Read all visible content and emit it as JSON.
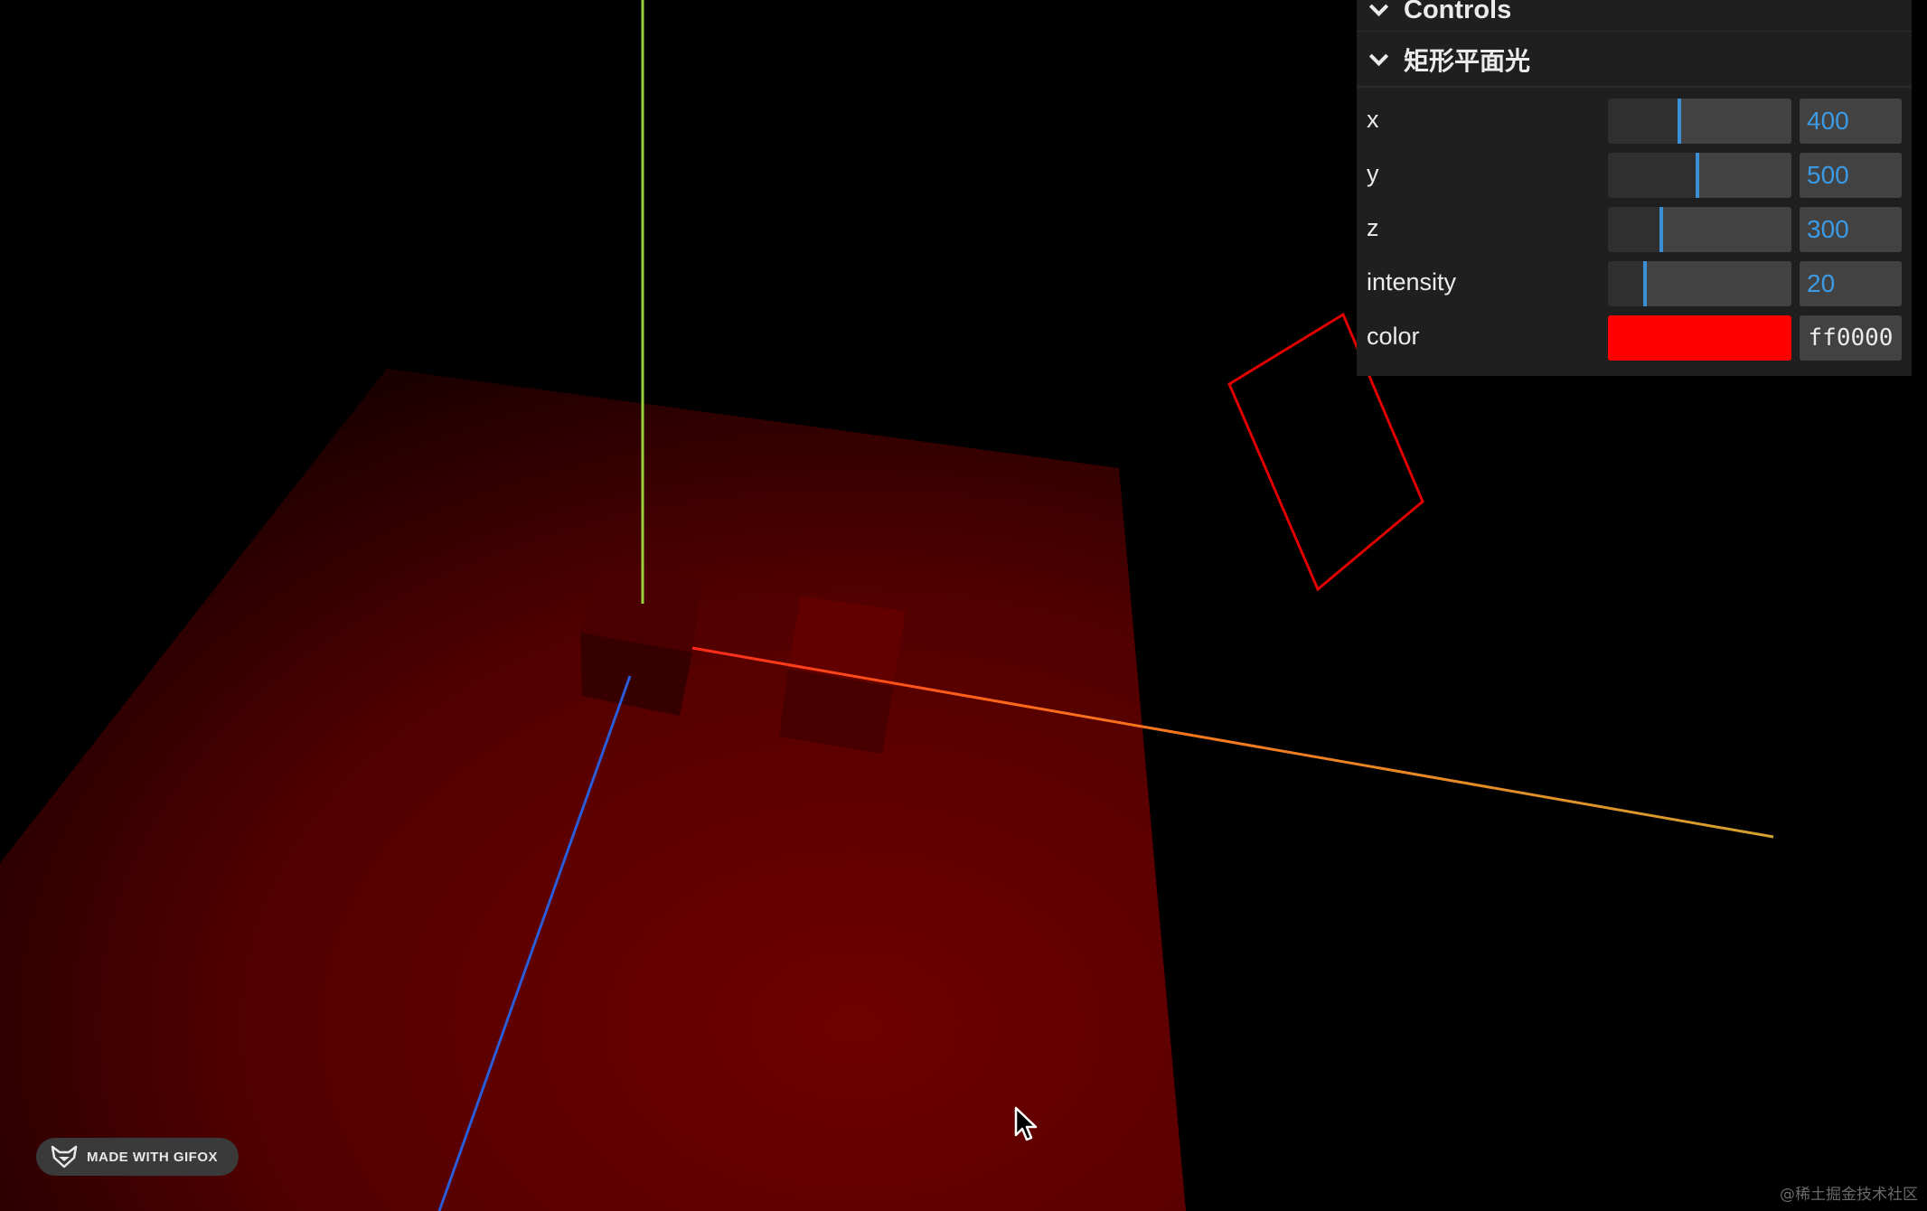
{
  "gui": {
    "title": "Controls",
    "folder_title": "矩形平面光",
    "params": [
      {
        "label": "x",
        "value": "400",
        "fraction": 0.39
      },
      {
        "label": "y",
        "value": "500",
        "fraction": 0.49
      },
      {
        "label": "z",
        "value": "300",
        "fraction": 0.29
      },
      {
        "label": "intensity",
        "value": "20",
        "fraction": 0.2
      }
    ],
    "color": {
      "label": "color",
      "value": "ff0000",
      "swatch": "#ff0000"
    }
  },
  "badge": {
    "label": "MADE WITH GIFOX",
    "icon": "fox-icon"
  },
  "watermark": "@稀土掘金技术社区",
  "scene": {
    "plane_color": "#7a0000",
    "x_axis_color": "#ff3a1a",
    "y_axis_color": "#9ad23a",
    "z_axis_color": "#2a5cd8",
    "rect_light_outline_color": "#e00000"
  }
}
